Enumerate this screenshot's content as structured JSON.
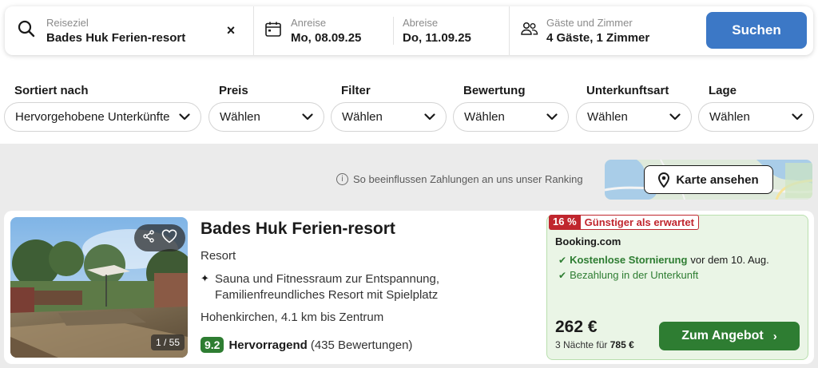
{
  "search": {
    "destination_label": "Reiseziel",
    "destination_value": "Bades Huk Ferien-resort",
    "clear_symbol": "×",
    "checkin_label": "Anreise",
    "checkin_value": "Mo, 08.09.25",
    "checkout_label": "Abreise",
    "checkout_value": "Do, 11.09.25",
    "guests_label": "Gäste und Zimmer",
    "guests_value": "4 Gäste, 1 Zimmer",
    "search_button": "Suchen",
    "icons": [
      "search-icon",
      "calendar-icon",
      "guests-icon",
      "close-icon"
    ]
  },
  "filters": [
    {
      "label": "Sortiert nach",
      "value": "Hervorgehobene Unterkünfte"
    },
    {
      "label": "Preis",
      "value": "Wählen"
    },
    {
      "label": "Filter",
      "value": "Wählen"
    },
    {
      "label": "Bewertung",
      "value": "Wählen"
    },
    {
      "label": "Unterkunftsart",
      "value": "Wählen"
    },
    {
      "label": "Lage",
      "value": "Wählen"
    }
  ],
  "ranking": {
    "info_symbol": "i",
    "text": "So beeinflussen Zahlungen an uns unser Ranking"
  },
  "map": {
    "button": "Karte ansehen"
  },
  "result": {
    "name": "Bades Huk Ferien-resort",
    "type": "Resort",
    "highlight_symbol": "✦",
    "description_line1": "Sauna und Fitnessraum zur Entspannung,",
    "description_line2": "Familienfreundliches Resort mit Spielplatz",
    "location": "Hohenkirchen, 4.1 km bis Zentrum",
    "rating_score": "9.2",
    "rating_word": "Hervorragend",
    "rating_count": "(435 Bewertungen)",
    "photo_counter": "1 / 55",
    "deal": {
      "badge_percent": "16 %",
      "badge_text": "Günstiger als erwartet",
      "provider": "Booking.com",
      "check_symbol": "✔",
      "feature1_bold": "Kostenlose Stornierung",
      "feature1_rest": "vor dem 10. Aug.",
      "feature2": "Bezahlung in der Unterkunft",
      "price": "262 €",
      "nights_text": "3 Nächte für",
      "nights_total": "785 €",
      "button": "Zum Angebot",
      "button_chevron": "›"
    }
  },
  "colors": {
    "primary_blue": "#3c78c6",
    "green": "#2e7d32",
    "deal_bg": "#eaf5e6",
    "badge_red": "#c0262e",
    "band_grey": "#ebebeb"
  }
}
